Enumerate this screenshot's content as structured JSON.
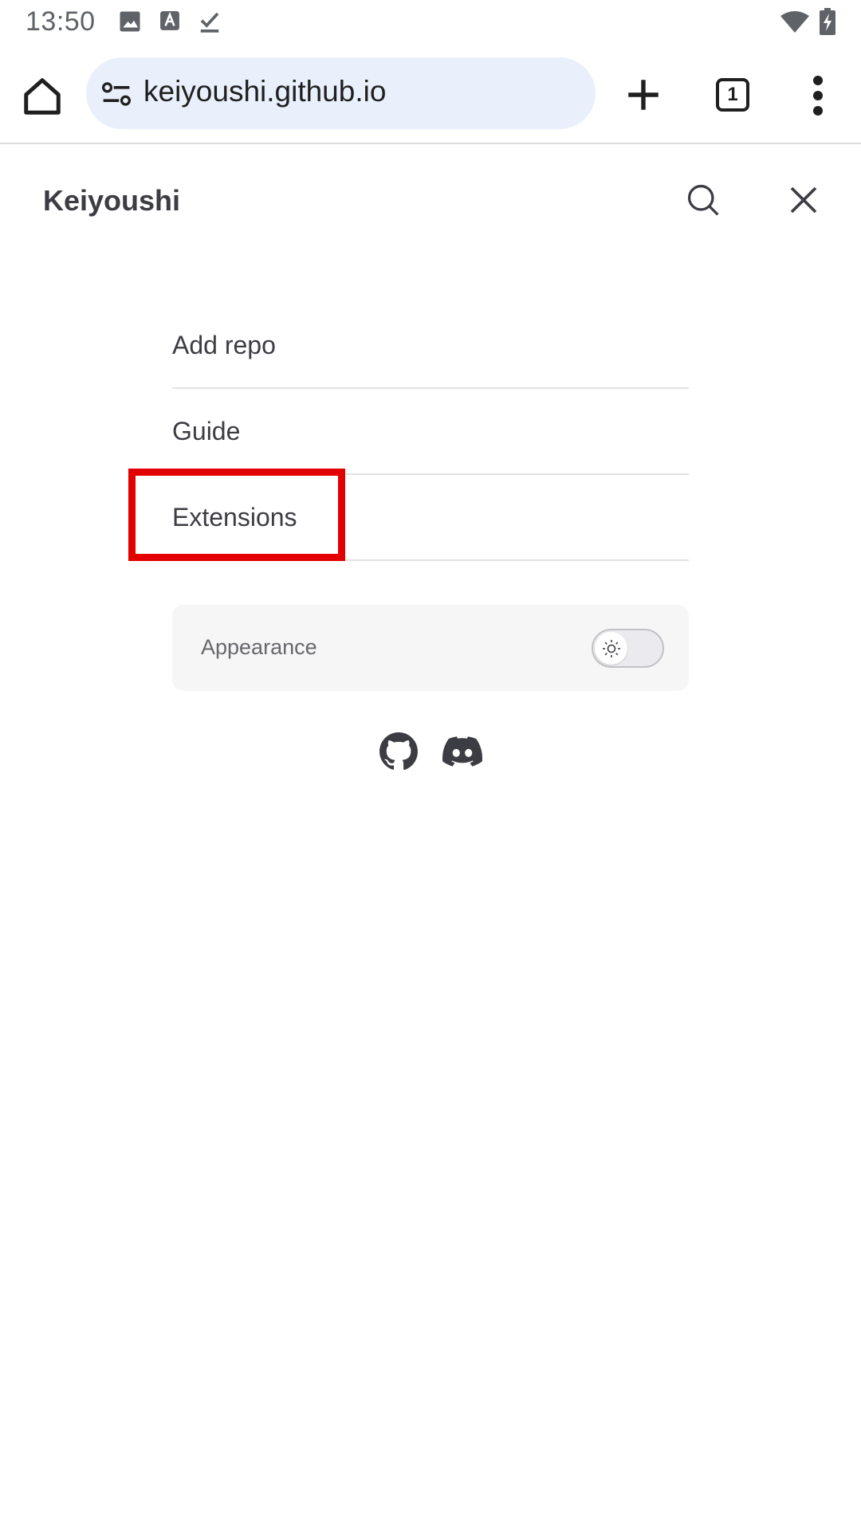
{
  "status_bar": {
    "time": "13:50",
    "left_icons": [
      "image-icon",
      "font-icon",
      "download-done-icon"
    ],
    "right_icons": [
      "wifi-icon",
      "battery-charging-icon"
    ]
  },
  "browser": {
    "url": "keiyoushi.github.io",
    "tab_count": "1",
    "icons": [
      "home-icon",
      "tune-icon",
      "plus-icon",
      "tabs-icon",
      "more-vert-icon"
    ]
  },
  "site": {
    "title": "Keiyoushi",
    "header_icons": [
      "search-icon",
      "close-icon"
    ]
  },
  "nav": {
    "items": [
      {
        "label": "Add repo"
      },
      {
        "label": "Guide"
      },
      {
        "label": "Extensions"
      }
    ]
  },
  "appearance": {
    "label": "Appearance",
    "mode": "light"
  },
  "social": [
    "github-icon",
    "discord-icon"
  ],
  "colors": {
    "highlight": "#e30000",
    "url_bar_bg": "#e9f0fb",
    "appearance_bg": "#f6f6f7"
  }
}
